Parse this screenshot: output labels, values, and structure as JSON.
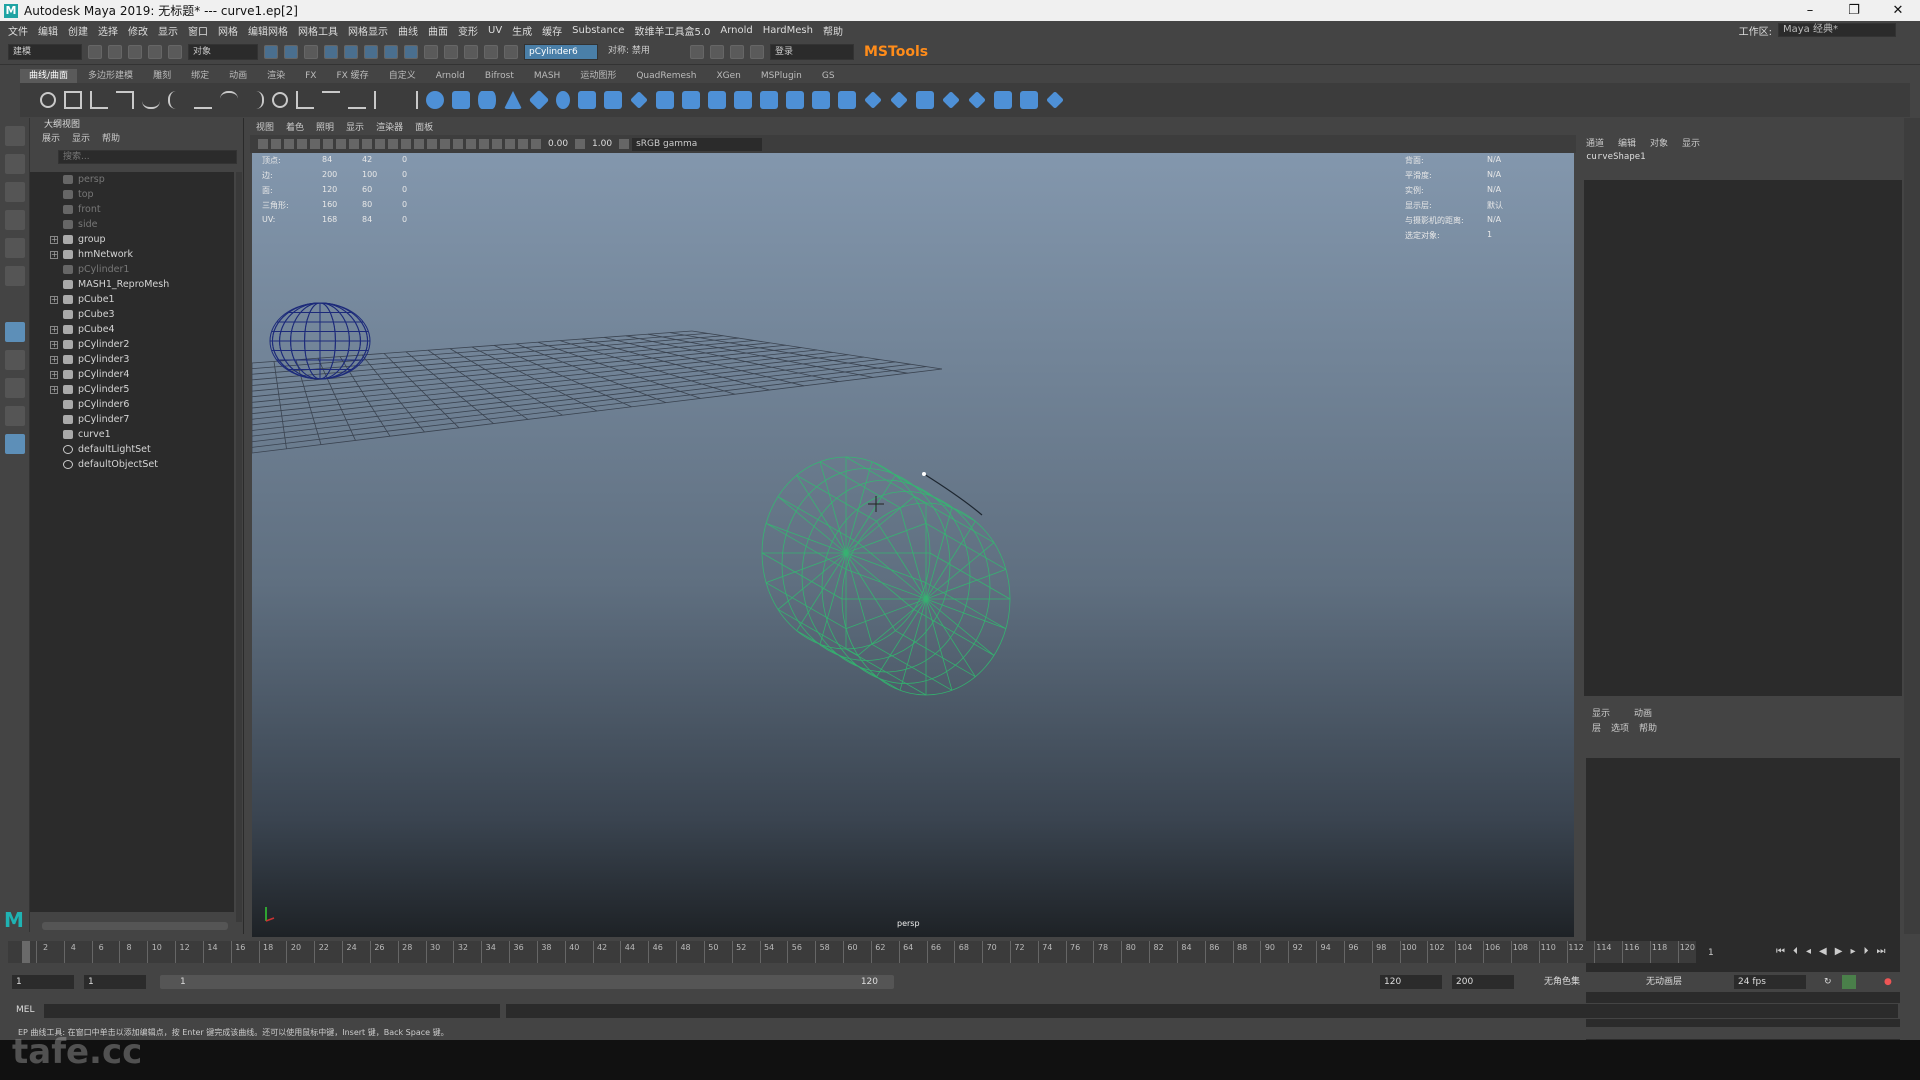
{
  "window": {
    "title": "Autodesk Maya 2019: 无标题*   ---   curve1.ep[2]",
    "controls": [
      "–",
      "❐",
      "✕"
    ]
  },
  "menubar": {
    "items": [
      "文件",
      "编辑",
      "创建",
      "选择",
      "修改",
      "显示",
      "窗口",
      "网格",
      "编辑网格",
      "网格工具",
      "网格显示",
      "曲线",
      "曲面",
      "变形",
      "UV",
      "生成",
      "缓存",
      "Substance",
      "致维羊工具盒5.0",
      "Arnold",
      "HardMesh",
      "帮助"
    ],
    "workspace_label": "工作区:",
    "workspace_value": "Maya 经典*"
  },
  "statusline": {
    "mode": "建模",
    "object_field": "对象",
    "selected_object": "pCylinder6",
    "symmetry": "对称: 禁用",
    "login": "登录",
    "plugin_label": "MSTools"
  },
  "shelf": {
    "tabs": [
      "曲线/曲面",
      "多边形建模",
      "雕刻",
      "绑定",
      "动画",
      "渲染",
      "FX",
      "FX 缓存",
      "自定义",
      "Arnold",
      "Bifrost",
      "MASH",
      "运动图形",
      "QuadRemesh",
      "XGen",
      "MSPlugin",
      "GS"
    ],
    "active_tab": 0
  },
  "outliner": {
    "title": "大纲视图",
    "menu": [
      "展示",
      "显示",
      "帮助"
    ],
    "search_placeholder": "搜索...",
    "items": [
      {
        "label": "persp",
        "type": "camera",
        "dim": true,
        "expand": false
      },
      {
        "label": "top",
        "type": "camera",
        "dim": true,
        "expand": false
      },
      {
        "label": "front",
        "type": "camera",
        "dim": true,
        "expand": false
      },
      {
        "label": "side",
        "type": "camera",
        "dim": true,
        "expand": false
      },
      {
        "label": "group",
        "type": "transform",
        "dim": false,
        "expand": true
      },
      {
        "label": "hmNetwork",
        "type": "transform",
        "dim": false,
        "expand": true
      },
      {
        "label": "pCylinder1",
        "type": "transform",
        "dim": true,
        "expand": false
      },
      {
        "label": "MASH1_ReproMesh",
        "type": "transform",
        "dim": false,
        "expand": false
      },
      {
        "label": "pCube1",
        "type": "transform",
        "dim": false,
        "expand": true
      },
      {
        "label": "pCube3",
        "type": "transform",
        "dim": false,
        "expand": false
      },
      {
        "label": "pCube4",
        "type": "transform",
        "dim": false,
        "expand": true
      },
      {
        "label": "pCylinder2",
        "type": "transform",
        "dim": false,
        "expand": true
      },
      {
        "label": "pCylinder3",
        "type": "transform",
        "dim": false,
        "expand": true
      },
      {
        "label": "pCylinder4",
        "type": "transform",
        "dim": false,
        "expand": true
      },
      {
        "label": "pCylinder5",
        "type": "transform",
        "dim": false,
        "expand": true
      },
      {
        "label": "pCylinder6",
        "type": "transform",
        "dim": false,
        "expand": false
      },
      {
        "label": "pCylinder7",
        "type": "transform",
        "dim": false,
        "expand": false
      },
      {
        "label": "curve1",
        "type": "curve",
        "dim": false,
        "expand": false
      },
      {
        "label": "defaultLightSet",
        "type": "set",
        "dim": false,
        "expand": false
      },
      {
        "label": "defaultObjectSet",
        "type": "set",
        "dim": false,
        "expand": false
      }
    ]
  },
  "viewport": {
    "menu": [
      "视图",
      "着色",
      "照明",
      "显示",
      "渲染器",
      "面板"
    ],
    "exposure": "0.00",
    "gamma": "1.00",
    "color_space": "sRGB gamma",
    "hud_left": [
      {
        "label": "顶点:",
        "a": "84",
        "b": "42",
        "c": "0"
      },
      {
        "label": "边:",
        "a": "200",
        "b": "100",
        "c": "0"
      },
      {
        "label": "面:",
        "a": "120",
        "b": "60",
        "c": "0"
      },
      {
        "label": "三角形:",
        "a": "160",
        "b": "80",
        "c": "0"
      },
      {
        "label": "UV:",
        "a": "168",
        "b": "84",
        "c": "0"
      }
    ],
    "hud_right": [
      {
        "label": "背面:",
        "value": "N/A"
      },
      {
        "label": "平滑度:",
        "value": "N/A"
      },
      {
        "label": "实例:",
        "value": "N/A"
      },
      {
        "label": "显示层:",
        "value": "默认"
      },
      {
        "label": "与摄影机的距离:",
        "value": "N/A"
      },
      {
        "label": "选定对象:",
        "value": "1"
      }
    ],
    "camera": "persp"
  },
  "channelbox": {
    "menu": [
      "通道",
      "编辑",
      "对象",
      "显示"
    ],
    "node": "curveShape1",
    "layer_tabs": [
      "显示",
      "动画"
    ],
    "layer_menu": [
      "层",
      "选项",
      "帮助"
    ]
  },
  "timeslider": {
    "ticks": [
      "2",
      "4",
      "6",
      "8",
      "10",
      "12",
      "14",
      "16",
      "18",
      "20",
      "22",
      "24",
      "26",
      "28",
      "30",
      "32",
      "34",
      "36",
      "38",
      "40",
      "42",
      "44",
      "46",
      "48",
      "50",
      "52",
      "54",
      "56",
      "58",
      "60",
      "62",
      "64",
      "66",
      "68",
      "70",
      "72",
      "74",
      "76",
      "78",
      "80",
      "82",
      "84",
      "86",
      "88",
      "90",
      "92",
      "94",
      "96",
      "98",
      "100",
      "102",
      "104",
      "106",
      "108",
      "110",
      "112",
      "114",
      "116",
      "118",
      "120"
    ],
    "current_frame": "1",
    "playhead_label": "1"
  },
  "rangeslider": {
    "start": "1",
    "anim_start": "1",
    "bar_start": "1",
    "bar_end": "120",
    "end": "120",
    "anim_end": "200",
    "char_set": "无角色集",
    "anim_layer": "无动画层",
    "fps": "24 fps"
  },
  "cmdline": {
    "label": "MEL"
  },
  "helpline": {
    "text": "EP 曲线工具: 在窗口中单击以添加编辑点，按 Enter 键完成该曲线。还可以使用鼠标中键，Insert 键，Back Space 键。"
  },
  "watermark": "tafe.cc"
}
